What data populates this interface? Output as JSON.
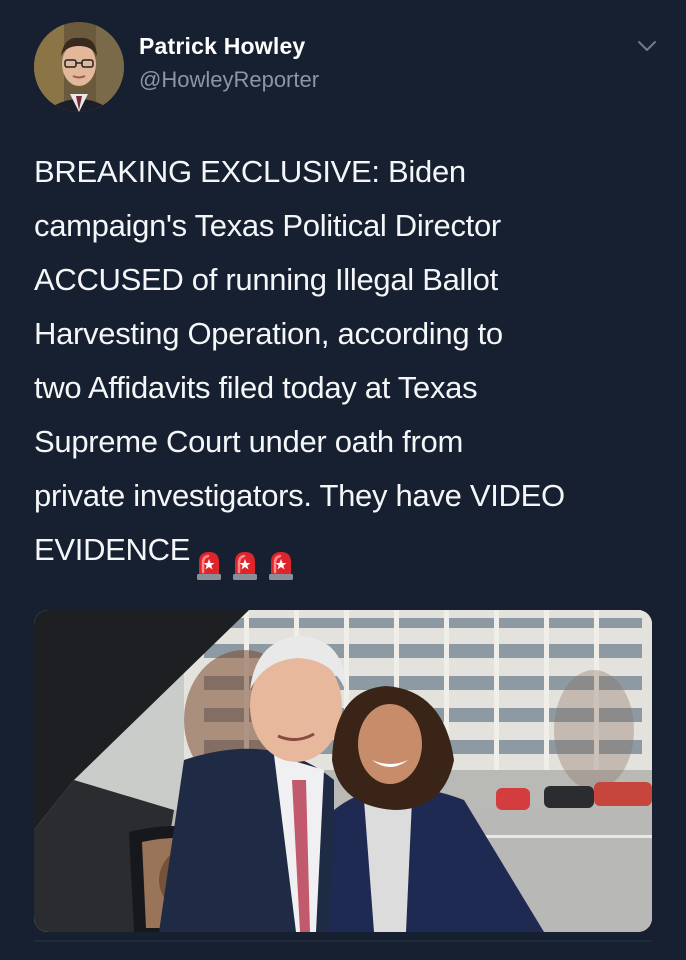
{
  "author": {
    "display_name": "Patrick Howley",
    "handle": "@HowleyReporter",
    "avatar_icon": "profile-photo",
    "menu_icon": "chevron-down-icon"
  },
  "tweet": {
    "lines": [
      "BREAKING EXCLUSIVE: Biden",
      "campaign's Texas Political Director",
      "ACCUSED of running Illegal Ballot",
      "Harvesting Operation, according to",
      "two Affidavits filed today at Texas",
      "Supreme Court under oath from",
      "private investigators. They have VIDEO",
      "EVIDENCE"
    ],
    "emoji": [
      "police-car-light-emoji",
      "police-car-light-emoji",
      "police-car-light-emoji"
    ]
  },
  "media": {
    "type": "photo"
  },
  "colors": {
    "background": "#172030",
    "text": "#f4f6f8",
    "secondary_text": "#8a96a5",
    "siren_red": "#e0242c"
  }
}
